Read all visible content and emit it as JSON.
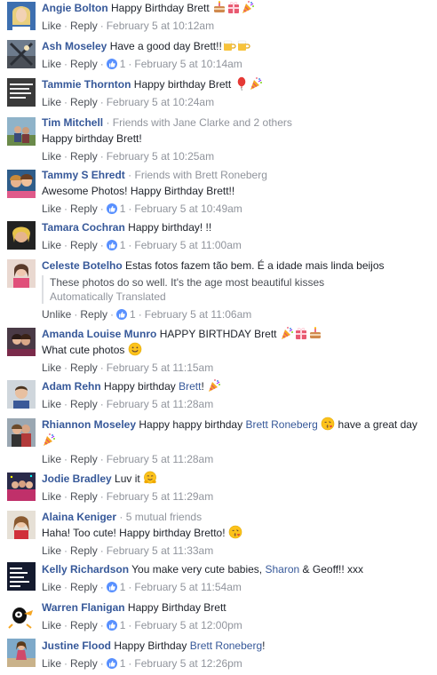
{
  "actions": {
    "like": "Like",
    "unlike": "Unlike",
    "reply": "Reply",
    "sep": "·"
  },
  "comments": [
    {
      "author": "Angie Bolton",
      "text": "Happy Birthday Brett",
      "likes": "",
      "time": "February 5 at 10:12am"
    },
    {
      "author": "Ash Moseley",
      "text": "Have a good day Brett!!",
      "likes": "1",
      "time": "February 5 at 10:14am"
    },
    {
      "author": "Tammie Thornton",
      "text": "Happy birthday Brett",
      "likes": "",
      "time": "February 5 at 10:24am"
    },
    {
      "author": "Tim Mitchell",
      "context": "· Friends with Jane Clarke and 2 others",
      "text": "Happy birthday Brett!",
      "likes": "",
      "time": "February 5 at 10:25am"
    },
    {
      "author": "Tammy S Ehredt",
      "context": "· Friends with Brett Roneberg",
      "text": "Awesome Photos! Happy Birthday Brett!!",
      "likes": "1",
      "time": "February 5 at 10:49am"
    },
    {
      "author": "Tamara Cochran",
      "text": "Happy birthday! !!",
      "likes": "1",
      "time": "February 5 at 11:00am"
    },
    {
      "author": "Celeste Botelho",
      "text": "Estas fotos fazem tão bem. É a idade mais linda beijos",
      "translation": "These photos do so well. It's the age most beautiful kisses",
      "translation_note": "Automatically Translated",
      "likes": "1",
      "time": "February 5 at 11:06am"
    },
    {
      "author": "Amanda Louise Munro",
      "text": "HAPPY BIRTHDAY Brett",
      "text2": "What cute photos",
      "likes": "",
      "time": "February 5 at 11:15am"
    },
    {
      "author": "Adam Rehn",
      "text": "Happy birthday",
      "tag": "Brett",
      "after": "!",
      "likes": "",
      "time": "February 5 at 11:28am"
    },
    {
      "author": "Rhiannon Moseley",
      "text": "Happy happy birthday",
      "tag": "Brett Roneberg",
      "after": "have a great day",
      "likes": "",
      "time": "February 5 at 11:28am"
    },
    {
      "author": "Jodie Bradley",
      "text": "Luv it",
      "likes": "",
      "time": "February 5 at 11:29am"
    },
    {
      "author": "Alaina Keniger",
      "context": "· 5 mutual friends",
      "text": "Haha! Too cute! Happy birthday Bretto!",
      "likes": "",
      "time": "February 5 at 11:33am"
    },
    {
      "author": "Kelly Richardson",
      "text": "You make very cute babies,",
      "tag": "Sharon",
      "mid": "&",
      "after": "Geoff!! xxx",
      "likes": "1",
      "time": "February 5 at 11:54am"
    },
    {
      "author": "Warren Flanigan",
      "text": "Happy Birthday Brett",
      "likes": "1",
      "time": "February 5 at 12:00pm"
    },
    {
      "author": "Justine Flood",
      "text": "Happy Birthday",
      "tag": "Brett Roneberg",
      "after": "!",
      "likes": "1",
      "time": "February 5 at 12:26pm"
    }
  ]
}
